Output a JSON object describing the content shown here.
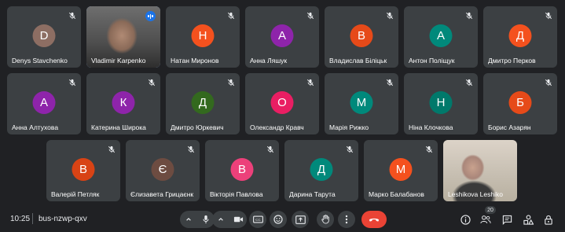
{
  "meeting": {
    "time": "10:25",
    "code": "bus-nzwp-qxv",
    "participant_count": "20"
  },
  "participants_row1": [
    {
      "name": "Denys Stavchenko",
      "initial": "D",
      "color": "#8d6e63"
    },
    {
      "name": "Vladimir Karpenko",
      "video": true,
      "speaking": true
    },
    {
      "name": "Натан Миронов",
      "initial": "Н",
      "color": "#f4511e"
    },
    {
      "name": "Анна Ляшук",
      "initial": "А",
      "color": "#8e24aa"
    },
    {
      "name": "Владислав Біліцьк",
      "initial": "В",
      "color": "#e64a19"
    },
    {
      "name": "Антон Поліщук",
      "initial": "А",
      "color": "#00897b"
    },
    {
      "name": "Дмитро Перков",
      "initial": "Д",
      "color": "#f4511e"
    }
  ],
  "participants_row2": [
    {
      "name": "Анна Алтухова",
      "initial": "А",
      "color": "#8e24aa"
    },
    {
      "name": "Катерина Широка",
      "initial": "К",
      "color": "#8e24aa"
    },
    {
      "name": "Дмитро Юркевич",
      "initial": "Д",
      "color": "#33691e"
    },
    {
      "name": "Олександр Кравч",
      "initial": "О",
      "color": "#e91e63"
    },
    {
      "name": "Марія Рижко",
      "initial": "М",
      "color": "#00897b"
    },
    {
      "name": "Ніна Клочкова",
      "initial": "Н",
      "color": "#00796b"
    },
    {
      "name": "Борис Азарян",
      "initial": "Б",
      "color": "#e64a19"
    }
  ],
  "participants_row3": [
    {
      "name": "Валерій Петляк",
      "initial": "В",
      "color": "#d84315"
    },
    {
      "name": "Єлизавета Грицаєнк",
      "initial": "Є",
      "color": "#6d4c41"
    },
    {
      "name": "Вікторія Павлова",
      "initial": "В",
      "color": "#ec407a"
    },
    {
      "name": "Дарина Тарута",
      "initial": "Д",
      "color": "#00897b"
    },
    {
      "name": "Марко Балабанов",
      "initial": "М",
      "color": "#f4511e"
    },
    {
      "name": "Leshikova Leshiko",
      "video": true
    }
  ],
  "icons": {
    "mic": "mic-icon",
    "camera": "camera-icon",
    "captions": "captions-icon",
    "emoji": "emoji-icon",
    "present": "present-icon",
    "hand": "raise-hand-icon",
    "more": "more-vert-icon",
    "end": "end-call-icon",
    "info": "info-icon",
    "people": "people-icon",
    "chat": "chat-icon",
    "activities": "activities-icon",
    "lock": "host-controls-icon"
  },
  "labels": {
    "captions": "CC"
  }
}
